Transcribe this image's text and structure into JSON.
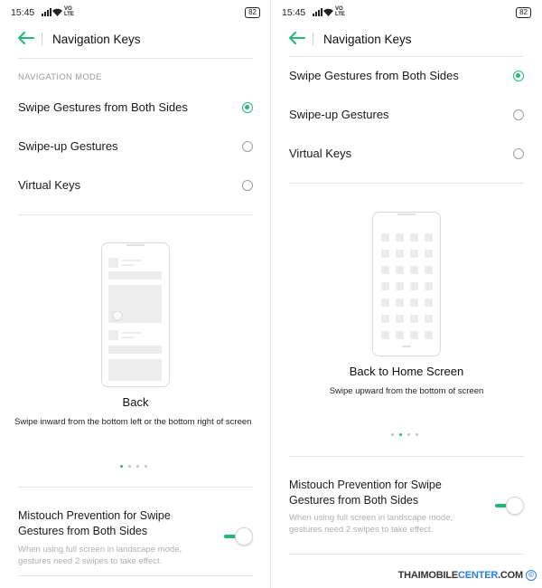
{
  "colors": {
    "accent": "#1fba75"
  },
  "left": {
    "status": {
      "time": "15:45",
      "volte": "VO\nLTE",
      "battery": "82"
    },
    "header": {
      "title": "Navigation Keys"
    },
    "section_label": "NAVIGATION MODE",
    "options": [
      {
        "label": "Swipe Gestures from Both Sides",
        "selected": true
      },
      {
        "label": "Swipe-up Gestures",
        "selected": false
      },
      {
        "label": "Virtual Keys",
        "selected": false
      }
    ],
    "caption": {
      "title": "Back",
      "desc": "Swipe inward from the bottom left or the bottom right of screen"
    },
    "pager": {
      "count": 4,
      "active": 1
    },
    "mistouch": {
      "title": "Mistouch Prevention for Swipe Gestures from Both Sides",
      "desc": "When using full screen in landscape mode, gestures need 2 swipes to take effect.",
      "enabled": true
    }
  },
  "right": {
    "status": {
      "time": "15:45",
      "volte": "VO\nLTE",
      "battery": "82"
    },
    "header": {
      "title": "Navigation Keys"
    },
    "options": [
      {
        "label": "Swipe Gestures from Both Sides",
        "selected": true
      },
      {
        "label": "Swipe-up Gestures",
        "selected": false
      },
      {
        "label": "Virtual Keys",
        "selected": false
      }
    ],
    "caption": {
      "title": "Back to Home Screen",
      "desc": "Swipe upward from the bottom of screen"
    },
    "pager": {
      "count": 4,
      "active": 2
    },
    "mistouch": {
      "title": "Mistouch Prevention for Swipe Gestures from Both Sides",
      "desc": "When using full screen in landscape mode, gestures need 2 swipes to take effect.",
      "enabled": true
    }
  },
  "watermark": {
    "main": "THAIMOBILE",
    "brand": "CENTER",
    "suffix": ".COM",
    "symbol": "©"
  }
}
